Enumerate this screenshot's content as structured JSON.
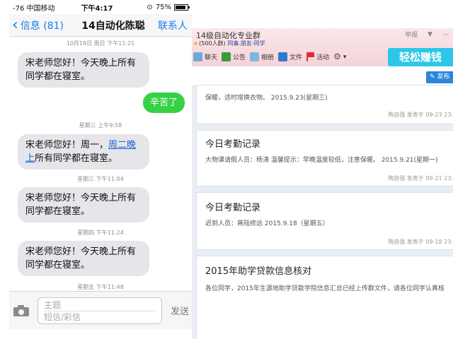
{
  "phone": {
    "status": {
      "signal": "-76 中国移动",
      "time": "下午4:17",
      "battery": "75%",
      "battery_fraction": 0.75
    },
    "nav": {
      "back_label": "信息 (81)",
      "title": "14自动化陈聪",
      "contact_label": "联系人"
    },
    "timestamps": [
      "10月18日 周日 下午11:21",
      "星期三 上午9:58",
      "星期三 下午11:04",
      "星期四 下午11:24",
      "星期五 下午11:48"
    ],
    "messages": [
      {
        "line1": "宋老师您好！今天晚上所有",
        "line2": "同学都在寝室。"
      },
      {
        "text": "辛苦了"
      },
      {
        "line1_pre": "宋老师您好！周一，",
        "link1": "周二晚",
        "link2": "上",
        "line2_post": "所有同学都在寝室。"
      },
      {
        "line1": "宋老师您好！今天晚上所有",
        "line2": "同学都在寝室。"
      },
      {
        "line1": "宋老师您好！今天晚上所有",
        "line2": "同学都在寝室。"
      }
    ],
    "input": {
      "subject_placeholder": "主题",
      "message_placeholder": "短信/彩信",
      "send_label": "发送"
    }
  },
  "qq": {
    "group_title": "14级自动化专业群",
    "member_count": "(500人群)",
    "tags": "同事.朋友-同学",
    "controls": {
      "report": "举报",
      "dropdown": "▼",
      "minimize": "—"
    },
    "toolbar": [
      "聊天",
      "公告",
      "相册",
      "文件",
      "活动"
    ],
    "earn_label": "轻松赚钱",
    "publish_label": "发布",
    "posts": [
      {
        "title": "",
        "body": "保暖，适时增换衣物。 2015.9.23(星期三)",
        "author": "陶自强",
        "posted": "发表于",
        "date": "09-23 23:"
      },
      {
        "title": "今日考勤记录",
        "body": "大物课请假人员：杨涛 温馨提示：早晚温度较低，注意保暖。 2015.9.21(星期一)",
        "author": "陶自强",
        "posted": "发表于",
        "date": "09-21 23:"
      },
      {
        "title": "今日考勤记录",
        "body": "迟到人员：蒋陆修远 2015.9.18（星期五）",
        "author": "陶自强",
        "posted": "发表于",
        "date": "09-18 23:"
      },
      {
        "title": "2015年助学贷款信息核对",
        "body": "各位同学，2015年生源地助学贷款学院信息汇总已经上传群文件，请各位同学认真核",
        "author": "",
        "posted": "",
        "date": ""
      }
    ]
  }
}
